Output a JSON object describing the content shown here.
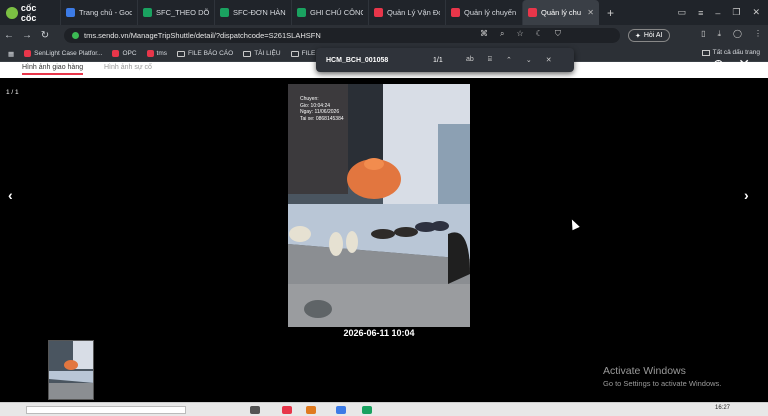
{
  "browser": {
    "brand": "cốc cốc",
    "tabs": [
      {
        "label": "Trang chủ - Goo",
        "icon": "blue"
      },
      {
        "label": "SFC_THEO DÕI (",
        "icon": "green"
      },
      {
        "label": "SFC-ĐƠN HÀNG",
        "icon": "green"
      },
      {
        "label": "GHI CHÚ CÔNG",
        "icon": "green"
      },
      {
        "label": "Quản Lý Vận Đơ",
        "icon": "red"
      },
      {
        "label": "Quản lý chuyến",
        "icon": "red"
      },
      {
        "label": "Quản lý chu",
        "icon": "red",
        "active": true
      }
    ],
    "url": "tms.sendo.vn/ManageTripShuttle/detail/?dispatchcode=S261SLAHSFN",
    "ask_ai": "Hỏi AI",
    "bookmarks": [
      "SenLight Case Platfor...",
      "OPC",
      "tms",
      "FILE BÁO CÁO",
      "TÀI LIỆU",
      "FILE CÔN"
    ],
    "all_bookmarks": "Tất cả dấu trang"
  },
  "find": {
    "query": "HCM_BCH_001058",
    "count": "1/1"
  },
  "page": {
    "tabs": [
      "Hình ảnh giao hàng",
      "Hình ảnh sự cố"
    ],
    "counter": "1 / 1",
    "overlay_lines": [
      "Chuyen: ",
      "Gio: 10:04:24",
      "Ngay: 11/06/2026",
      "Tai xe: 0868145384"
    ],
    "caption": "2026-06-11 10:04"
  },
  "watermark": {
    "title": "Activate Windows",
    "subtitle": "Go to Settings to activate Windows."
  },
  "taskbar": {
    "time": "16:27"
  }
}
